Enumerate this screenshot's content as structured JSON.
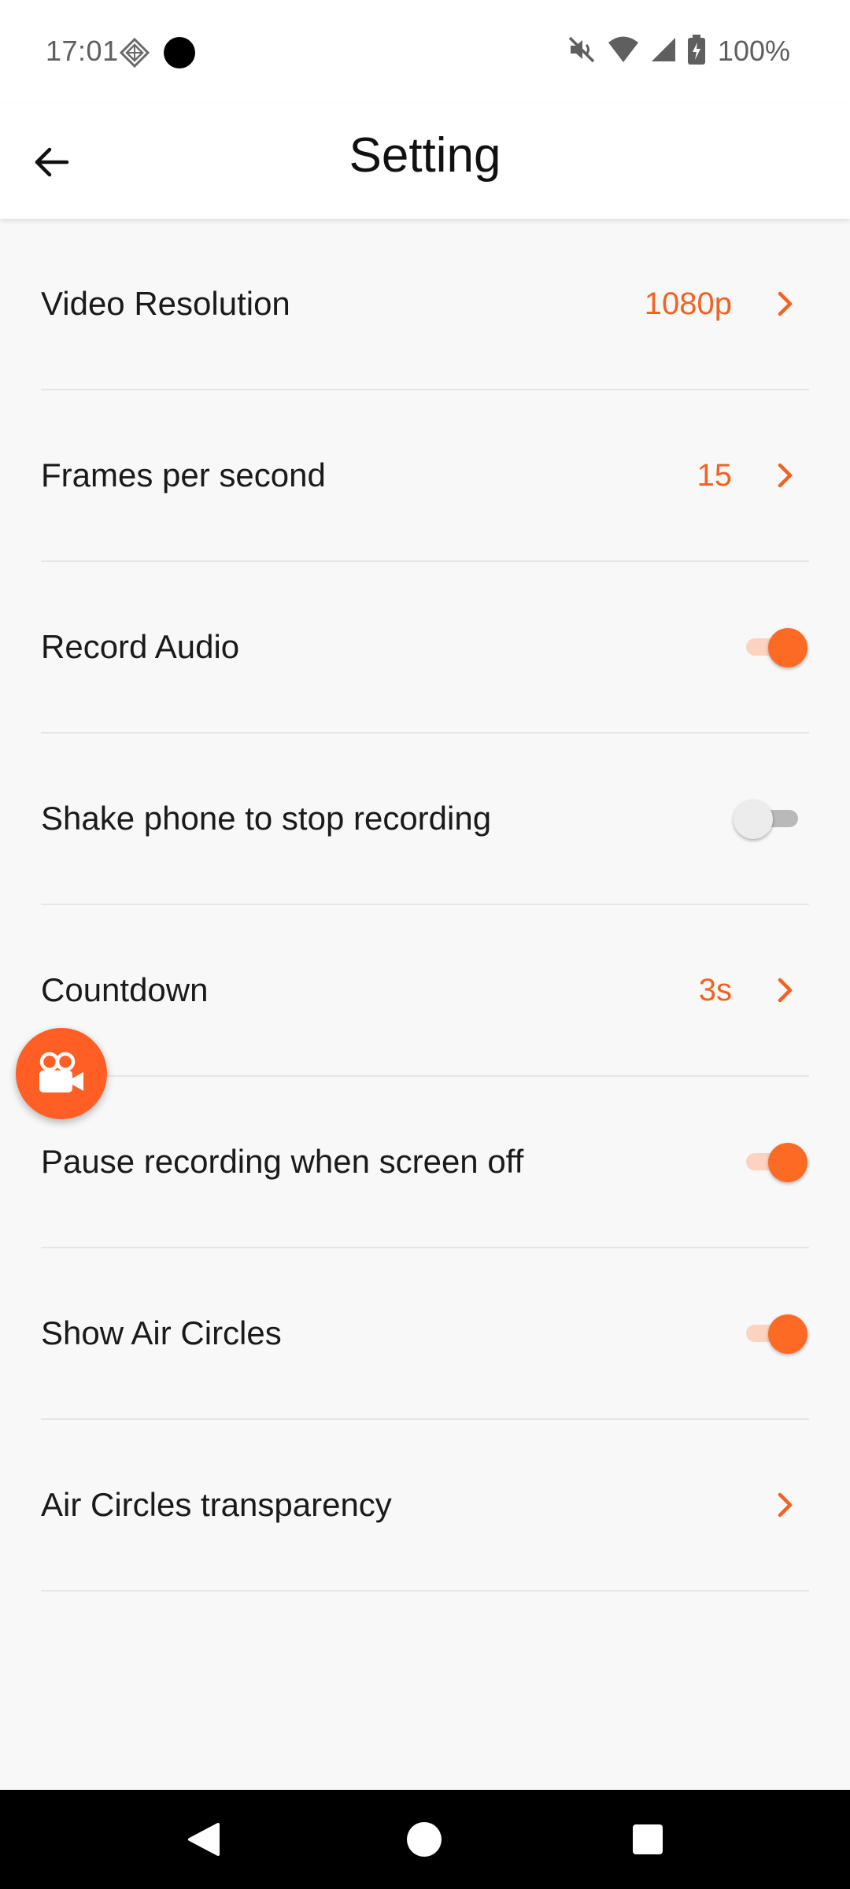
{
  "status_bar": {
    "time": "17:01",
    "battery": "100%",
    "icons": [
      "app-notification-icon",
      "record-dot-icon",
      "mute-icon",
      "wifi-icon",
      "signal-icon",
      "battery-charging-icon"
    ]
  },
  "header": {
    "title": "Setting",
    "back_icon": "back-arrow-icon"
  },
  "settings": {
    "video_resolution": {
      "label": "Video Resolution",
      "value": "1080p"
    },
    "fps": {
      "label": "Frames per second",
      "value": "15"
    },
    "record_audio": {
      "label": "Record Audio",
      "enabled": true
    },
    "shake_stop": {
      "label": "Shake phone to stop recording",
      "enabled": false
    },
    "countdown": {
      "label": "Countdown",
      "value": "3s"
    },
    "pause_screen_off": {
      "label": "Pause recording when screen off",
      "enabled": true
    },
    "show_air_circles": {
      "label": "Show Air Circles",
      "enabled": true
    },
    "air_circles_transparency": {
      "label": "Air Circles transparency"
    }
  },
  "fab": {
    "icon": "video-camera-icon"
  },
  "nav_bar": {
    "icons": [
      "nav-back-icon",
      "nav-home-icon",
      "nav-recents-icon"
    ]
  },
  "colors": {
    "accent": "#f26322",
    "toggle_on_knob": "#fd6a24",
    "toggle_on_track": "#fcd3c0",
    "background": "#f8f8f8"
  }
}
